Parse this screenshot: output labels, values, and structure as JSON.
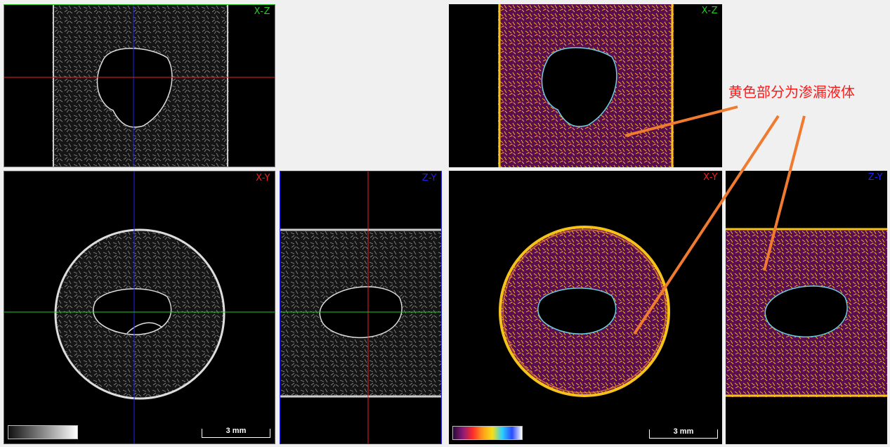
{
  "views": {
    "xz": "X-Z",
    "xy": "X-Y",
    "zy": "Z-Y"
  },
  "colors": {
    "xz": "#22cc22",
    "xy": "#ee2222",
    "zy": "#2222ee",
    "callout": "#ff1a1a",
    "arrow": "#f07a30",
    "leak_yellow": "#f5c21a",
    "leak_magenta": "#8a1a78"
  },
  "scalebar": {
    "label": "3 mm"
  },
  "colormap_left": "grayscale",
  "colormap_right": "spectrum",
  "annotation": {
    "text": "黄色部分为渗漏液体"
  }
}
